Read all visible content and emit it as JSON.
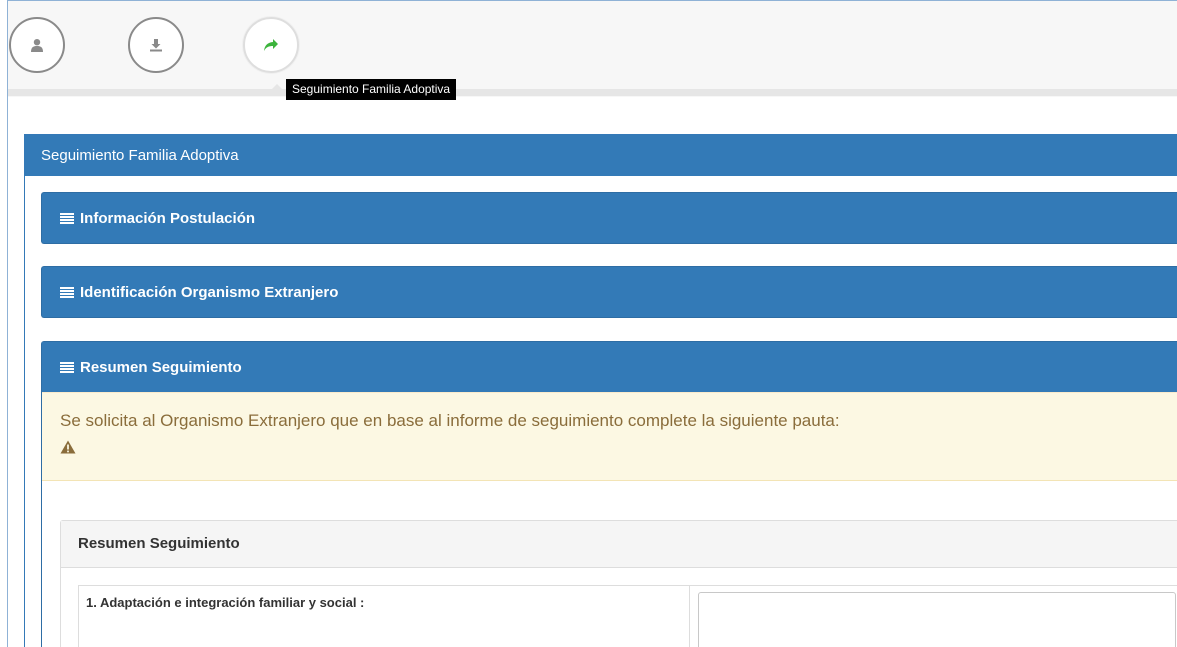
{
  "wizard": {
    "steps": [
      {
        "icon": "user-icon",
        "state": "done"
      },
      {
        "icon": "download-icon",
        "state": "done"
      },
      {
        "icon": "share-arrow-icon",
        "state": "active",
        "color": "#3cb43c"
      }
    ],
    "tooltip": "Seguimiento Familia Adoptiva"
  },
  "main_panel": {
    "title": "Seguimiento Familia Adoptiva",
    "header_color": "#337ab7"
  },
  "sections": {
    "postulacion": "Información Postulación",
    "organismo": "Identificación Organismo Extranjero",
    "resumen": "Resumen Seguimiento"
  },
  "warning": {
    "text": "Se solicita al Organismo Extranjero que en base al informe de seguimiento complete la siguiente pauta:",
    "icon": "warning-icon"
  },
  "inner_panel": {
    "title": "Resumen Seguimiento"
  },
  "questions": [
    {
      "label": "1. Adaptación e integración familiar y social :",
      "value": ""
    }
  ]
}
